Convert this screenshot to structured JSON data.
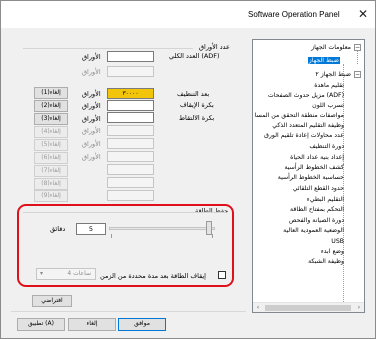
{
  "window": {
    "title": "Software Operation Panel",
    "close_glyph": "✕"
  },
  "tree": {
    "items": [
      {
        "label": "معلومات الجهاز"
      },
      {
        "label": "ضبط الجهاز",
        "selected": true
      },
      {
        "label": "ضبط الجهاز ٢"
      },
      {
        "label": "تقليم ماهدة"
      },
      {
        "label": "مزيل حدوث الصفحات (ADF)"
      },
      {
        "label": "تسرب اللون"
      },
      {
        "label": "مواصفات منطقة التحقق من المسا"
      },
      {
        "label": "وظيفة التقليم المتعدد الذكي"
      },
      {
        "label": "عدد محاولات إعادة تلقيم الورق"
      },
      {
        "label": "دورة التنظيف"
      },
      {
        "label": "إعداد بنية عداد الحياة"
      },
      {
        "label": "كشف الخطوط الرأسية"
      },
      {
        "label": "حساسية الخطوط الرأسية"
      },
      {
        "label": "حدود القطع التلقائي"
      },
      {
        "label": "التقليم البطيء"
      },
      {
        "label": "التحكم بمفتاح الطاقة"
      },
      {
        "label": "دورة الصيانة والفحص"
      },
      {
        "label": "الوضعية العمودية العالية"
      },
      {
        "label": "USB"
      },
      {
        "label": "وضع ابدء"
      },
      {
        "label": "وظيفة الشبكة"
      }
    ]
  },
  "counters": {
    "section_title": "عدد الأوراق",
    "adf_label": "العدد الكلي (ADF)",
    "sheets_unit": "الأوراق",
    "after_cleaning_label": "بعد التنظيف",
    "after_cleaning_value": "٣٠٠٠٠",
    "brake_roller_label": "بكرة الإيقاف",
    "pick_roller_label": "بكرة الالتقاط",
    "clear_label": "إلغاء(1)",
    "clear_label_2": "إلغاء(2)",
    "clear_label_3": "إلغاء(3)",
    "clear_label_4": "إلغاء(4)",
    "clear_label_5": "إلغاء(5)",
    "clear_label_6": "إلغاء(6)",
    "clear_label_7": "إلغاء(7)",
    "clear_label_8": "إلغاء(8)",
    "clear_label_9": "إلغاء(9)"
  },
  "power_saving": {
    "title": "حفظ الطاقة",
    "minutes_value": "5",
    "minutes_unit": "دقائق",
    "auto_off_label": "إيقاف الطاقة بعد مدة محددة من الزمن",
    "auto_off_checked": false,
    "hours_value": "4 ساعات"
  },
  "buttons": {
    "default": "افتراضي",
    "ok": "موافق",
    "cancel": "إلغاء",
    "apply": "تطبيق (A)"
  }
}
